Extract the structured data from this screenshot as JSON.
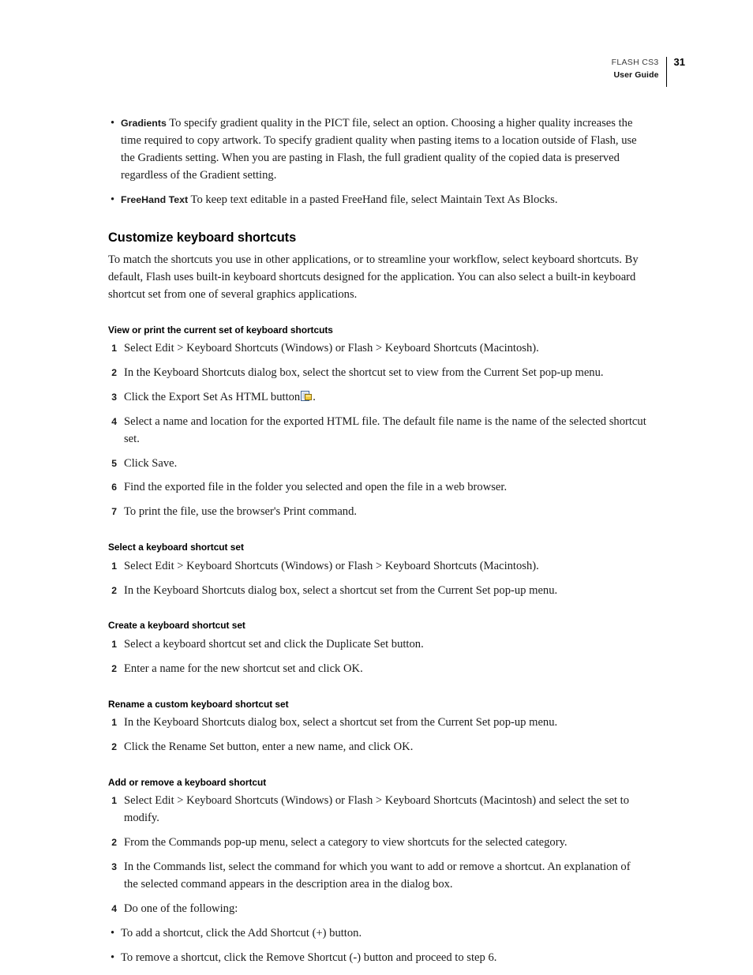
{
  "header": {
    "product": "FLASH CS3",
    "guide": "User Guide",
    "page_number": "31"
  },
  "top_bullets": [
    {
      "term": "Gradients",
      "text": "To specify gradient quality in the PICT file, select an option. Choosing a higher quality increases the time required to copy artwork. To specify gradient quality when pasting items to a location outside of Flash, use the Gradients setting. When you are pasting in Flash, the full gradient quality of the copied data is preserved regardless of the Gradient setting."
    },
    {
      "term": "FreeHand Text",
      "text": "To keep text editable in a pasted FreeHand file, select Maintain Text As Blocks."
    }
  ],
  "section": {
    "title": "Customize keyboard shortcuts",
    "intro": "To match the shortcuts you use in other applications, or to streamline your workflow, select keyboard shortcuts. By default, Flash uses built-in keyboard shortcuts designed for the application. You can also select a built-in keyboard shortcut set from one of several graphics applications."
  },
  "subsections": [
    {
      "heading": "View or print the current set of keyboard shortcuts",
      "steps": [
        {
          "num": "1",
          "text": "Select Edit > Keyboard Shortcuts (Windows) or Flash > Keyboard Shortcuts (Macintosh)."
        },
        {
          "num": "2",
          "text": "In the Keyboard Shortcuts dialog box, select the shortcut set to view from the Current Set pop-up menu."
        },
        {
          "num": "3",
          "text_before_icon": "Click the Export Set As HTML button",
          "icon": "export-html-icon",
          "text_after_icon": "."
        },
        {
          "num": "4",
          "text": "Select a name and location for the exported HTML file. The default file name is the name of the selected shortcut set."
        },
        {
          "num": "5",
          "text": "Click Save."
        },
        {
          "num": "6",
          "text": "Find the exported file in the folder you selected and open the file in a web browser."
        },
        {
          "num": "7",
          "text": "To print the file, use the browser's Print command."
        }
      ]
    },
    {
      "heading": "Select a keyboard shortcut set",
      "steps": [
        {
          "num": "1",
          "text": "Select Edit > Keyboard Shortcuts (Windows) or Flash > Keyboard Shortcuts (Macintosh)."
        },
        {
          "num": "2",
          "text": "In the Keyboard Shortcuts dialog box, select a shortcut set from the Current Set pop-up menu."
        }
      ]
    },
    {
      "heading": "Create a keyboard shortcut set",
      "steps": [
        {
          "num": "1",
          "text": "Select a keyboard shortcut set and click the Duplicate Set button."
        },
        {
          "num": "2",
          "text": "Enter a name for the new shortcut set and click OK."
        }
      ]
    },
    {
      "heading": "Rename a custom keyboard shortcut set",
      "steps": [
        {
          "num": "1",
          "text": "In the Keyboard Shortcuts dialog box, select a shortcut set from the Current Set pop-up menu."
        },
        {
          "num": "2",
          "text": "Click the Rename Set button, enter a new name, and click OK."
        }
      ]
    },
    {
      "heading": "Add or remove a keyboard shortcut",
      "steps": [
        {
          "num": "1",
          "text": "Select Edit > Keyboard Shortcuts (Windows) or Flash > Keyboard Shortcuts (Macintosh) and select the set to modify."
        },
        {
          "num": "2",
          "text": "From the Commands pop-up menu, select a category to view shortcuts for the selected category."
        },
        {
          "num": "3",
          "text": "In the Commands list, select the command for which you want to add or remove a shortcut. An explanation of the selected command appears in the description area in the dialog box."
        },
        {
          "num": "4",
          "text": "Do one of the following:"
        }
      ],
      "sub_bullets": [
        "To add a shortcut, click the Add Shortcut (+) button.",
        "To remove a shortcut, click the Remove Shortcut (-) button and proceed to step 6."
      ]
    }
  ],
  "bullet_glyph": "•",
  "colors": {
    "text": "#1a1a1a",
    "heading": "#000000",
    "header_rule": "#000000",
    "icon_page": "#ffffff",
    "icon_border": "#4a6e9c",
    "icon_accent": "#f2c830"
  }
}
